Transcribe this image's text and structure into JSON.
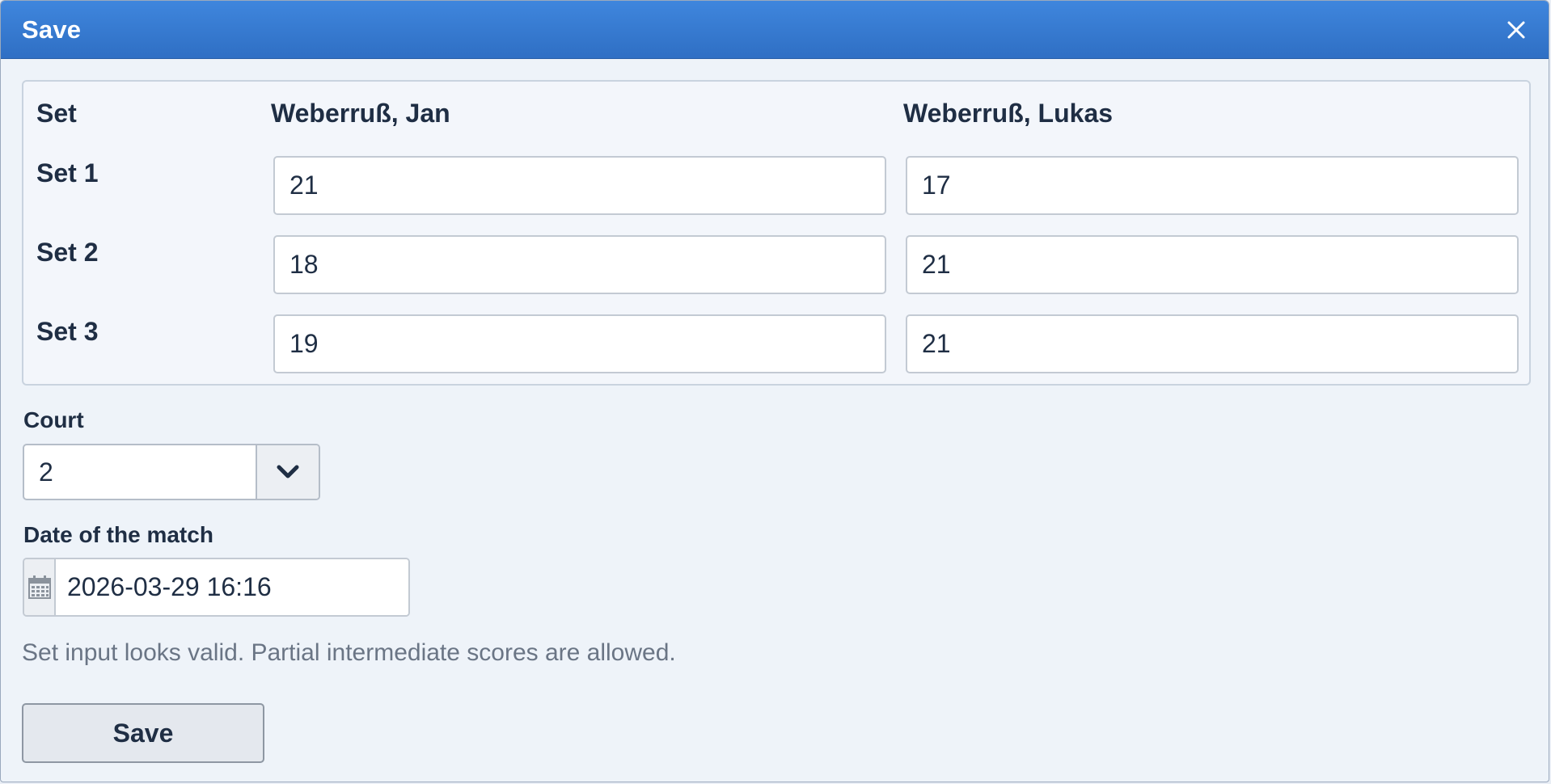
{
  "dialog": {
    "title": "Save",
    "close_icon": "close-icon"
  },
  "sets": {
    "header_label": "Set",
    "player1": "Weberruß, Jan",
    "player2": "Weberruß, Lukas",
    "rows": [
      {
        "label": "Set 1",
        "p1": "21",
        "p2": "17"
      },
      {
        "label": "Set 2",
        "p1": "18",
        "p2": "21"
      },
      {
        "label": "Set 3",
        "p1": "19",
        "p2": "21"
      }
    ]
  },
  "court": {
    "label": "Court",
    "value": "2",
    "dropdown_icon": "chevron-down-icon"
  },
  "match_date": {
    "label": "Date of the match",
    "value": "2026-03-29 16:16",
    "icon": "calendar-icon"
  },
  "hint": "Set input looks valid. Partial intermediate scores are allowed.",
  "save_button": "Save",
  "colors": {
    "titlebar": "#3f86dd",
    "text": "#1f2e44",
    "background": "#eef3f9"
  }
}
